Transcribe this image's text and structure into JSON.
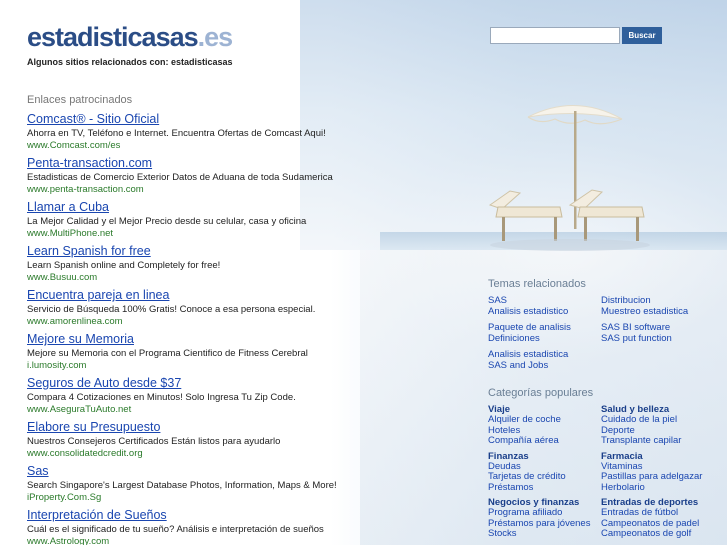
{
  "header": {
    "logo_main": "estadisticasas",
    "logo_tld": ".es",
    "related_line": "Algunos sitios relacionados con: estadisticasas",
    "search_button": "Buscar",
    "search_value": ""
  },
  "sponsored": {
    "title": "Enlaces patrocinados",
    "ads": [
      {
        "title": "Comcast® - Sitio Oficial",
        "desc": "Ahorra en TV, Teléfono e Internet. Encuentra Ofertas de Comcast Aqui!",
        "url": "www.Comcast.com/es"
      },
      {
        "title": "Penta-transaction.com",
        "desc": "Estadisticas de Comercio Exterior Datos de Aduana de toda Sudamerica",
        "url": "www.penta-transaction.com"
      },
      {
        "title": "Llamar a Cuba",
        "desc": "La Mejor Calidad y el Mejor Precio desde su celular, casa y oficina",
        "url": "www.MultiPhone.net"
      },
      {
        "title": "Learn Spanish for free",
        "desc": "Learn Spanish online and Completely for free!",
        "url": "www.Busuu.com"
      },
      {
        "title": "Encuentra pareja en linea",
        "desc": "Servicio de Búsqueda 100% Gratis! Conoce a esa persona especial.",
        "url": "www.amorenlinea.com"
      },
      {
        "title": "Mejore su Memoria",
        "desc": "Mejore su Memoria con el Programa Cientifico de Fitness Cerebral",
        "url": "i.lumosity.com"
      },
      {
        "title": "Seguros de Auto desde $37",
        "desc": "Compara 4 Cotizaciones en Minutos! Solo Ingresa Tu Zip Code.",
        "url": "www.AseguraTuAuto.net"
      },
      {
        "title": "Elabore su Presupuesto",
        "desc": "Nuestros Consejeros Certificados Están listos para ayudarlo",
        "url": "www.consolidatedcredit.org"
      },
      {
        "title": "Sas",
        "desc": "Search Singapore's Largest Database Photos, Information, Maps & More!",
        "url": "iProperty.Com.Sg"
      },
      {
        "title": "Interpretación de Sueños",
        "desc": "Cuál es el significado de tu sueño? Análisis e interpretación de sueños",
        "url": "www.Astrology.com"
      }
    ]
  },
  "themes": {
    "title": "Temas relacionados",
    "groups": [
      {
        "left": [
          "SAS",
          "Analisis estadistico"
        ],
        "right": [
          "Distribucion",
          "Muestreo estadistica"
        ]
      },
      {
        "left": [
          "Paquete de analisis",
          "Definiciones"
        ],
        "right": [
          "SAS BI software",
          "SAS put function"
        ]
      },
      {
        "left": [
          "Analisis estadistica",
          "SAS and Jobs"
        ],
        "right": []
      }
    ]
  },
  "categories": {
    "title": "Categorías populares",
    "rows": [
      {
        "left": {
          "head": "Viaje",
          "links": [
            "Alquiler de coche",
            "Hoteles",
            "Compañía aérea"
          ]
        },
        "right": {
          "head": "Salud y belleza",
          "links": [
            "Cuidado de la piel",
            "Deporte",
            "Transplante capilar"
          ]
        }
      },
      {
        "left": {
          "head": "Finanzas",
          "links": [
            "Deudas",
            "Tarjetas de crédito",
            "Préstamos"
          ]
        },
        "right": {
          "head": "Farmacia",
          "links": [
            "Vitaminas",
            "Pastillas para adelgazar",
            "Herbolario"
          ]
        }
      },
      {
        "left": {
          "head": "Negocios y finanzas",
          "links": [
            "Programa afiliado",
            "Préstamos para jóvenes",
            "Stocks"
          ]
        },
        "right": {
          "head": "Entradas de deportes",
          "links": [
            "Entradas de fútbol",
            "Campeonatos de padel",
            "Campeonatos de golf"
          ]
        }
      }
    ]
  }
}
